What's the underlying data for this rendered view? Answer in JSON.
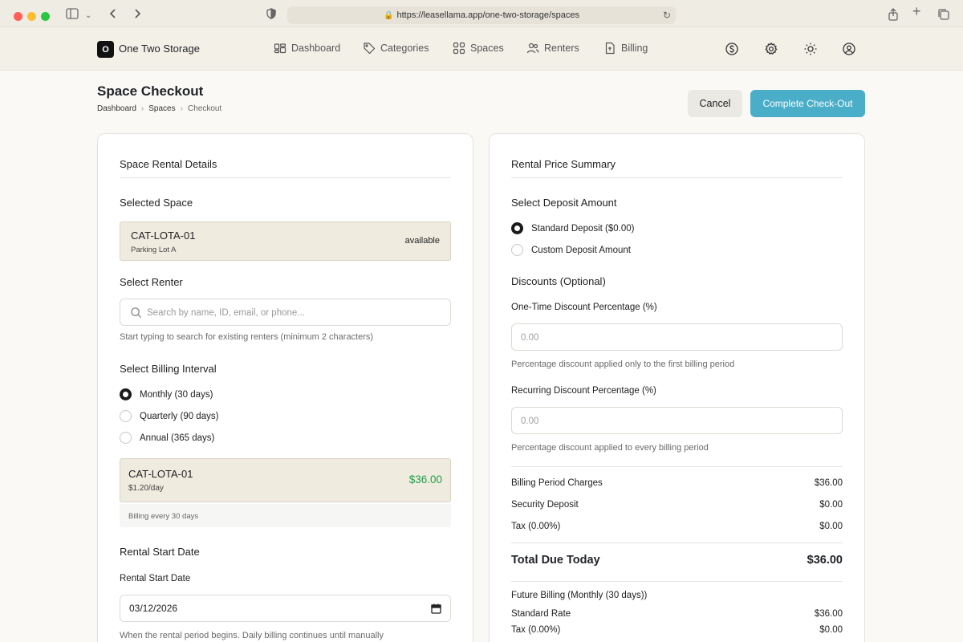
{
  "browser": {
    "url": "https://leasellama.app/one-two-storage/spaces"
  },
  "header": {
    "logo_letter": "O",
    "brand": "One Two Storage",
    "nav": [
      {
        "label": "Dashboard",
        "icon": "dashboard-icon"
      },
      {
        "label": "Categories",
        "icon": "tag-icon"
      },
      {
        "label": "Spaces",
        "icon": "grid-icon"
      },
      {
        "label": "Renters",
        "icon": "users-icon"
      },
      {
        "label": "Billing",
        "icon": "document-icon"
      }
    ],
    "right_icons": [
      "dollar-icon",
      "gear-icon",
      "sun-icon",
      "user-circle-icon"
    ]
  },
  "page": {
    "title": "Space Checkout",
    "breadcrumb": [
      "Dashboard",
      "Spaces",
      "Checkout"
    ],
    "cancel_label": "Cancel",
    "complete_label": "Complete Check-Out"
  },
  "left": {
    "title": "Space Rental Details",
    "selected_space_label": "Selected Space",
    "space_code": "CAT-LOTA-01",
    "space_location": "Parking Lot A",
    "space_status": "available",
    "renter_label": "Select Renter",
    "renter_placeholder": "Search by name, ID, email, or phone...",
    "renter_helper": "Start typing to search for existing renters (minimum 2 characters)",
    "interval_label": "Select Billing Interval",
    "intervals": [
      {
        "label": "Monthly (30 days)",
        "checked": true
      },
      {
        "label": "Quarterly (90 days)",
        "checked": false
      },
      {
        "label": "Annual (365 days)",
        "checked": false
      }
    ],
    "interval_code": "CAT-LOTA-01",
    "interval_rate": "$1.20/day",
    "interval_price": "$36.00",
    "interval_note": "Billing every 30 days",
    "start_date_section": "Rental Start Date",
    "start_date_label": "Rental Start Date",
    "start_date_value": "03/12/2026",
    "start_date_helper": "When the rental period begins. Daily billing continues until manually"
  },
  "right": {
    "title": "Rental Price Summary",
    "deposit_label": "Select Deposit Amount",
    "deposits": [
      {
        "label": "Standard Deposit ($0.00)",
        "checked": true
      },
      {
        "label": "Custom Deposit Amount",
        "checked": false
      }
    ],
    "discounts_label": "Discounts (Optional)",
    "one_time_label": "One-Time Discount Percentage (%)",
    "one_time_placeholder": "0.00",
    "one_time_helper": "Percentage discount applied only to the first billing period",
    "recurring_label": "Recurring Discount Percentage (%)",
    "recurring_placeholder": "0.00",
    "recurring_helper": "Percentage discount applied to every billing period",
    "summary": [
      {
        "label": "Billing Period Charges",
        "value": "$36.00"
      },
      {
        "label": "Security Deposit",
        "value": "$0.00"
      },
      {
        "label": "Tax (0.00%)",
        "value": "$0.00"
      }
    ],
    "total_label": "Total Due Today",
    "total_value": "$36.00",
    "future_label": "Future Billing (Monthly (30 days))",
    "future": [
      {
        "label": "Standard Rate",
        "value": "$36.00"
      },
      {
        "label": "Tax (0.00%)",
        "value": "$0.00"
      }
    ]
  }
}
